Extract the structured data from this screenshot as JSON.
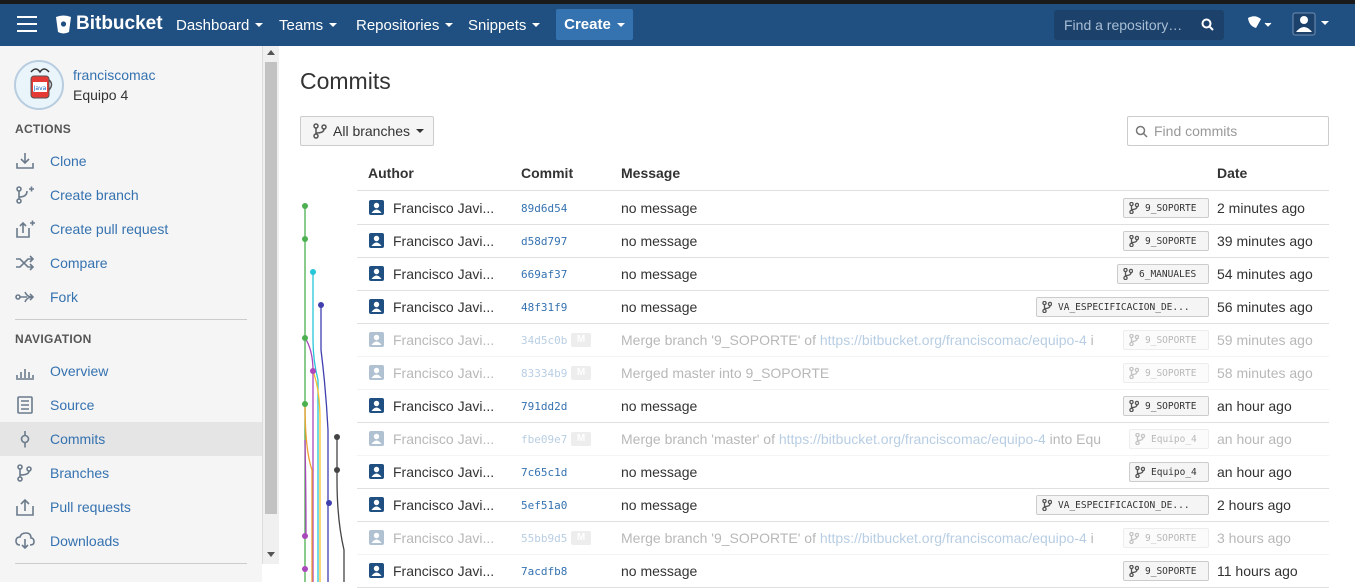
{
  "topbar": {
    "logo": "Bitbucket",
    "nav": [
      "Dashboard",
      "Teams",
      "Repositories",
      "Snippets"
    ],
    "create": "Create",
    "search_placeholder": "Find a repository…"
  },
  "sidebar": {
    "user": "franciscomac",
    "repo": "Equipo 4",
    "actions_title": "ACTIONS",
    "actions": [
      "Clone",
      "Create branch",
      "Create pull request",
      "Compare",
      "Fork"
    ],
    "navigation_title": "NAVIGATION",
    "navigation": [
      "Overview",
      "Source",
      "Commits",
      "Branches",
      "Pull requests",
      "Downloads"
    ],
    "active": "Commits"
  },
  "main": {
    "title": "Commits",
    "branch_filter": "All branches",
    "find_placeholder": "Find commits",
    "columns": {
      "author": "Author",
      "commit": "Commit",
      "message": "Message",
      "date": "Date"
    },
    "commits": [
      {
        "author": "Francisco Javi...",
        "hash": "89d6d54",
        "message": "no message",
        "link": "",
        "suffix": "",
        "branch": "9_SOPORTE",
        "date": "2 minutes ago",
        "merge": false
      },
      {
        "author": "Francisco Javi...",
        "hash": "d58d797",
        "message": "no message",
        "link": "",
        "suffix": "",
        "branch": "9_SOPORTE",
        "date": "39 minutes ago",
        "merge": false
      },
      {
        "author": "Francisco Javi...",
        "hash": "669af37",
        "message": "no message",
        "link": "",
        "suffix": "",
        "branch": "6_MANUALES",
        "date": "54 minutes ago",
        "merge": false
      },
      {
        "author": "Francisco Javi...",
        "hash": "48f31f9",
        "message": "no message",
        "link": "",
        "suffix": "",
        "branch": "VA_ESPECIFICACION_DE...",
        "date": "56 minutes ago",
        "merge": false
      },
      {
        "author": "Francisco Javi...",
        "hash": "34d5c0b",
        "message": "Merge branch '9_SOPORTE' of ",
        "link": "https://bitbucket.org/franciscomac/equipo-4",
        "suffix": " i",
        "branch": "9_SOPORTE",
        "date": "59 minutes ago",
        "merge": true
      },
      {
        "author": "Francisco Javi...",
        "hash": "83334b9",
        "message": "Merged master into 9_SOPORTE",
        "link": "",
        "suffix": "",
        "branch": "9_SOPORTE",
        "date": "58 minutes ago",
        "merge": true
      },
      {
        "author": "Francisco Javi...",
        "hash": "791dd2d",
        "message": "no message",
        "link": "",
        "suffix": "",
        "branch": "9_SOPORTE",
        "date": "an hour ago",
        "merge": false
      },
      {
        "author": "Francisco Javi...",
        "hash": "fbe09e7",
        "message": "Merge branch 'master' of ",
        "link": "https://bitbucket.org/franciscomac/equipo-4",
        "suffix": " into Equ",
        "branch": "Equipo_4",
        "date": "an hour ago",
        "merge": true
      },
      {
        "author": "Francisco Javi...",
        "hash": "7c65c1d",
        "message": "no message",
        "link": "",
        "suffix": "",
        "branch": "Equipo_4",
        "date": "an hour ago",
        "merge": false
      },
      {
        "author": "Francisco Javi...",
        "hash": "5ef51a0",
        "message": "no message",
        "link": "",
        "suffix": "",
        "branch": "VA_ESPECIFICACION_DE...",
        "date": "2 hours ago",
        "merge": false
      },
      {
        "author": "Francisco Javi...",
        "hash": "55bb9d5",
        "message": "Merge branch '9_SOPORTE' of ",
        "link": "https://bitbucket.org/franciscomac/equipo-4",
        "suffix": " i",
        "branch": "9_SOPORTE",
        "date": "3 hours ago",
        "merge": true
      },
      {
        "author": "Francisco Javi...",
        "hash": "7acdfb8",
        "message": "no message",
        "link": "",
        "suffix": "",
        "branch": "9_SOPORTE",
        "date": "11 hours ago",
        "merge": false
      }
    ],
    "merge_badge": "M"
  },
  "colors": {
    "header": "#205081",
    "link": "#3572b0",
    "graph": [
      "#4caf50",
      "#26c6da",
      "#ab47bc",
      "#3f3fb0",
      "#fbc02d",
      "#444444"
    ]
  }
}
